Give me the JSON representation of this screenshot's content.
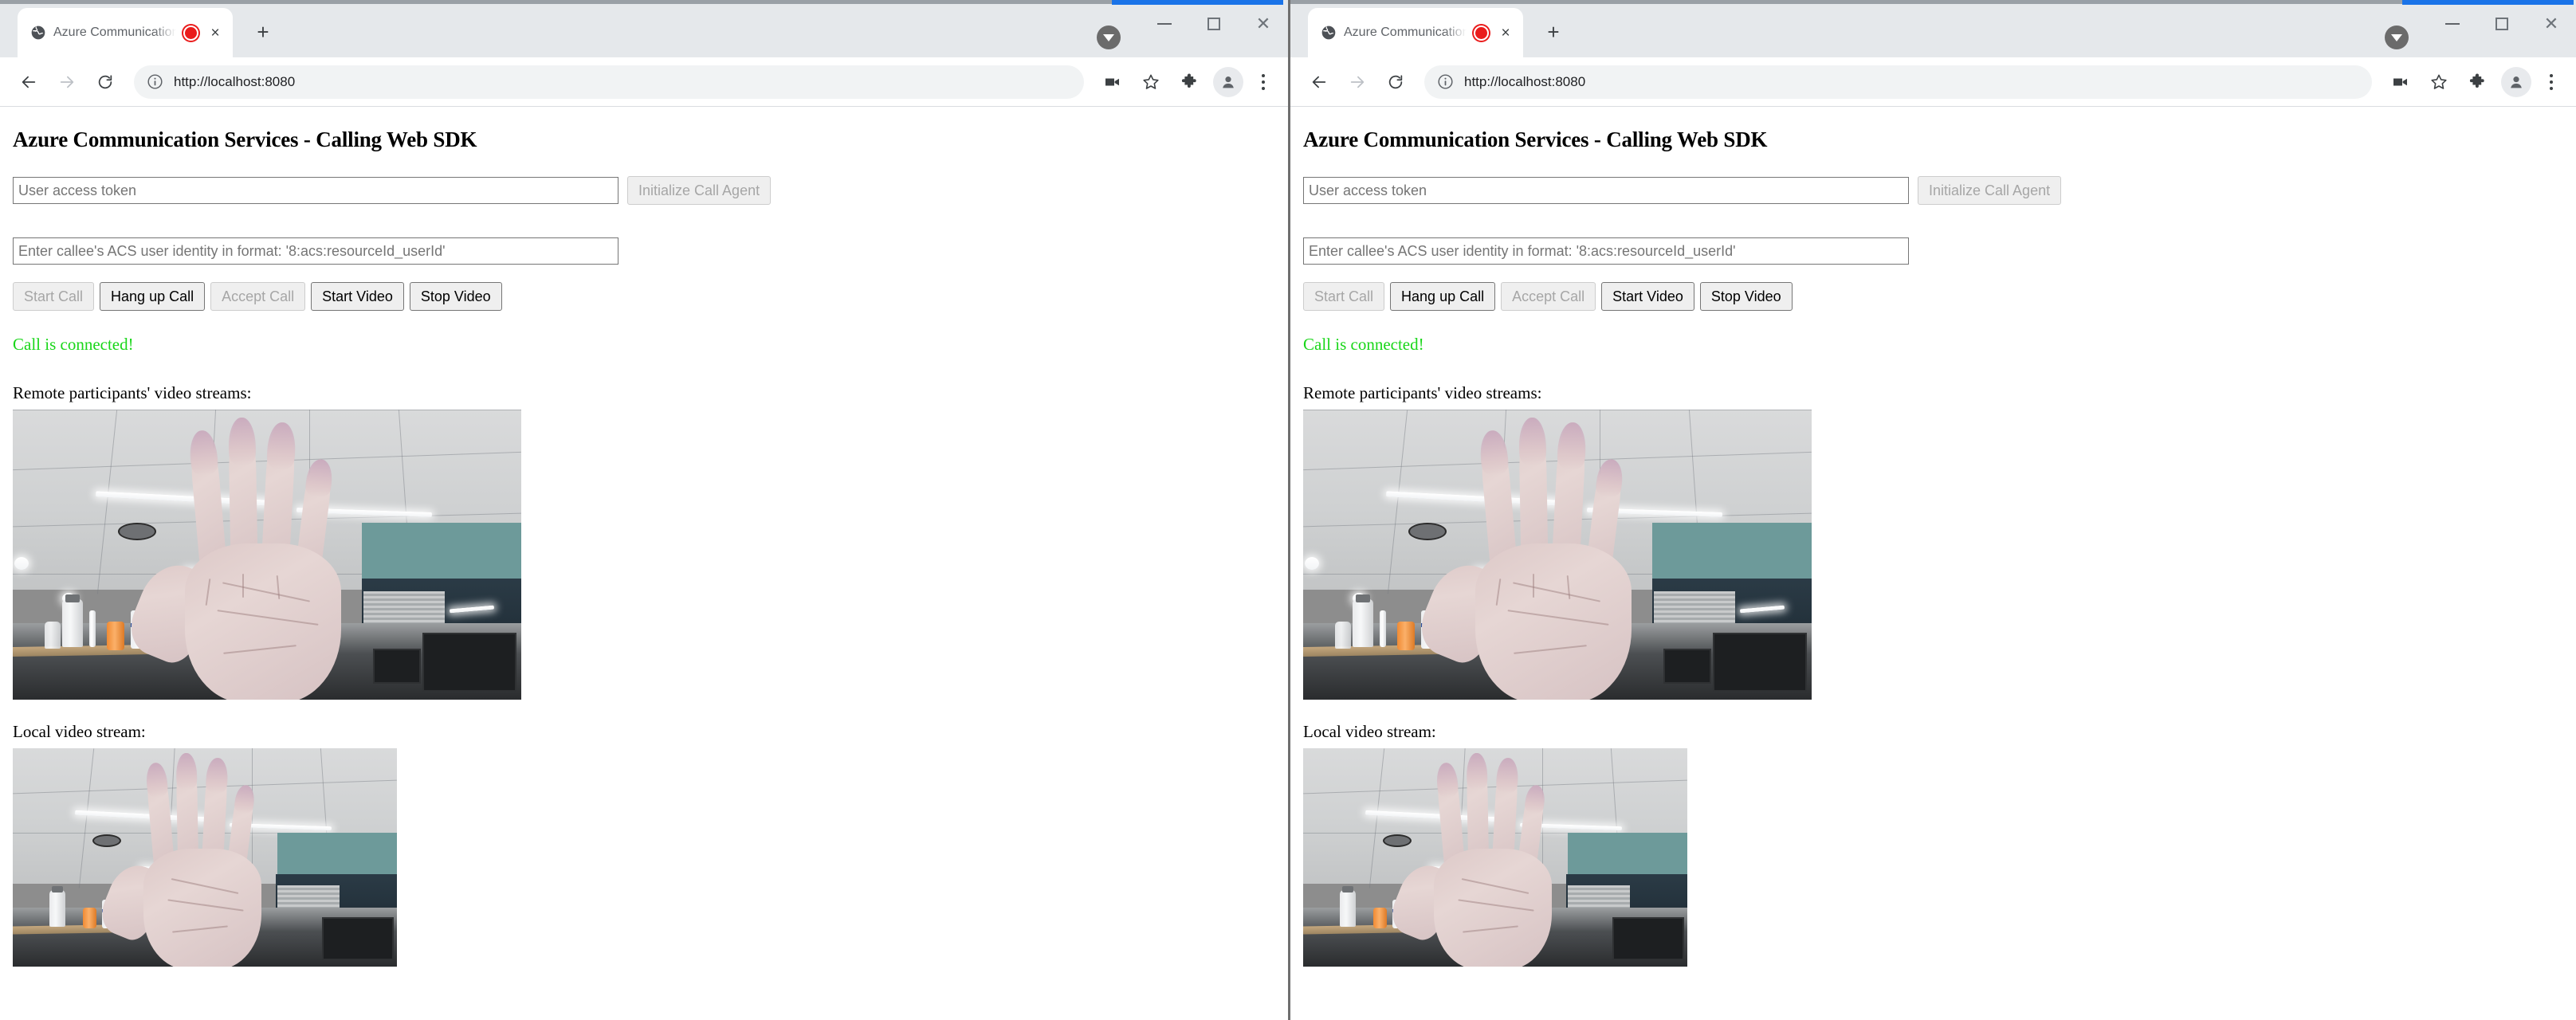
{
  "windows": [
    {
      "id": "left",
      "browser": {
        "tab": {
          "title": "Azure Communication Servic",
          "favicon_name": "globe-favicon",
          "recording_indicator": "recording-dot",
          "close_label": "×"
        },
        "new_tab_label": "+",
        "nav": {
          "back_label": "←",
          "forward_label": "→",
          "reload_label": "⟳"
        },
        "omnibox": {
          "url": "http://localhost:8080",
          "security_icon": "info-circle-icon"
        },
        "toolbar_icons": [
          "video-camera-icon",
          "star-icon",
          "puzzle-extensions-icon",
          "profile-avatar-icon",
          "kebab-menu-icon"
        ],
        "window_controls": {
          "download_indicator": "download-arrow-icon",
          "minimize_label": "—",
          "maximize_label": "□",
          "close_label": "✕"
        }
      },
      "page": {
        "title": "Azure Communication Services - Calling Web SDK",
        "token_input_placeholder": "User access token",
        "token_input_value": "",
        "initialize_button": "Initialize Call Agent",
        "initialize_button_disabled": true,
        "callee_input_placeholder": "Enter callee's ACS user identity in format: '8:acs:resourceId_userId'",
        "callee_input_value": "",
        "buttons": [
          {
            "label": "Start Call",
            "disabled": true
          },
          {
            "label": "Hang up Call",
            "disabled": false
          },
          {
            "label": "Accept Call",
            "disabled": true
          },
          {
            "label": "Start Video",
            "disabled": false
          },
          {
            "label": "Stop Video",
            "disabled": false
          }
        ],
        "status_text": "Call is connected!",
        "status_color": "#19d619",
        "remote_label": "Remote participants' video streams:",
        "local_label": "Local video stream:",
        "remote_video_alt": "office ceiling with open palm raised toward camera",
        "local_video_alt": "office ceiling with open palm raised toward camera"
      }
    },
    {
      "id": "right",
      "browser": {
        "tab": {
          "title": "Azure Communication Servic",
          "favicon_name": "globe-favicon",
          "recording_indicator": "recording-dot",
          "close_label": "×"
        },
        "new_tab_label": "+",
        "nav": {
          "back_label": "←",
          "forward_label": "→",
          "reload_label": "⟳"
        },
        "omnibox": {
          "url": "http://localhost:8080",
          "security_icon": "info-circle-icon"
        },
        "toolbar_icons": [
          "video-camera-icon",
          "star-icon",
          "puzzle-extensions-icon",
          "profile-avatar-icon",
          "kebab-menu-icon"
        ],
        "window_controls": {
          "download_indicator": "download-arrow-icon",
          "minimize_label": "—",
          "maximize_label": "□",
          "close_label": "✕"
        }
      },
      "page": {
        "title": "Azure Communication Services - Calling Web SDK",
        "token_input_placeholder": "User access token",
        "token_input_value": "",
        "initialize_button": "Initialize Call Agent",
        "initialize_button_disabled": true,
        "callee_input_placeholder": "Enter callee's ACS user identity in format: '8:acs:resourceId_userId'",
        "callee_input_value": "",
        "buttons": [
          {
            "label": "Start Call",
            "disabled": true
          },
          {
            "label": "Hang up Call",
            "disabled": false
          },
          {
            "label": "Accept Call",
            "disabled": true
          },
          {
            "label": "Start Video",
            "disabled": false
          },
          {
            "label": "Stop Video",
            "disabled": false
          }
        ],
        "status_text": "Call is connected!",
        "status_color": "#19d619",
        "remote_label": "Remote participants' video streams:",
        "local_label": "Local video stream:",
        "remote_video_alt": "office ceiling with open palm raised toward camera",
        "local_video_alt": "office ceiling with open palm raised toward camera"
      }
    }
  ],
  "theme": {
    "accent": "#1a73e8",
    "toolbar_bg": "#ffffff",
    "tabstrip_bg": "#e5e8eb",
    "status_green": "#19d619",
    "disabled_text": "#a6a6a6"
  }
}
